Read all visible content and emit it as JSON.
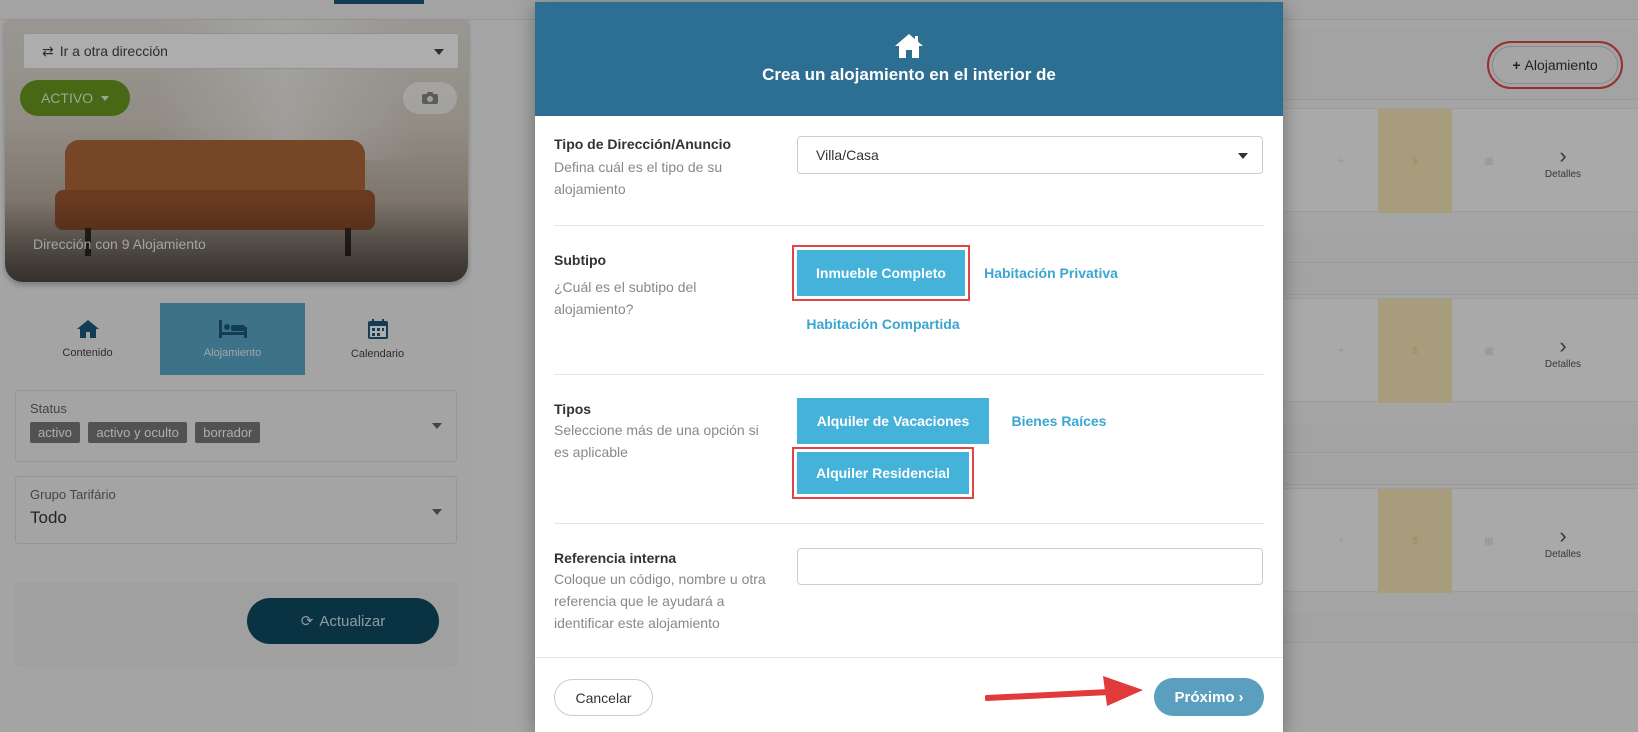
{
  "background": {
    "goto_select": {
      "label": "Ir a otra dirección"
    },
    "status_badge": "ACTIVO",
    "hero_caption": "Dirección con 9 Alojamiento",
    "nav_tabs": [
      {
        "label": "Contenido",
        "icon": "home-icon"
      },
      {
        "label": "Alojamiento",
        "icon": "bed-icon",
        "active": true
      },
      {
        "label": "Calendario",
        "icon": "calendar-icon"
      }
    ],
    "status_filter": {
      "label": "Status",
      "chips": [
        "activo",
        "activo y oculto",
        "borrador"
      ]
    },
    "tariff_filter": {
      "label": "Grupo Tarifário",
      "value": "Todo"
    },
    "update_button": "Actualizar",
    "add_lodging_button": "Alojamiento",
    "row_details_label": "Detalles"
  },
  "modal": {
    "title": "Crea un alojamiento en el interior de",
    "address_type": {
      "label": "Tipo de Dirección/Anuncio",
      "description": "Defina cuál es el tipo de su alojamiento",
      "selected": "Villa/Casa"
    },
    "subtype": {
      "label": "Subtipo",
      "description": "¿Cuál es el subtipo del alojamiento?",
      "options": [
        "Inmueble Completo",
        "Habitación Privativa",
        "Habitación Compartida"
      ]
    },
    "types": {
      "label": "Tipos",
      "description": "Seleccione más de una opción si es aplicable",
      "options": [
        "Alquiler de Vacaciones",
        "Bienes Raíces",
        "Alquiler Residencial"
      ]
    },
    "internal_ref": {
      "label": "Referencia interna",
      "description": "Coloque un código, nombre u otra referencia que le ayudará a identificar este alojamiento",
      "value": "",
      "placeholder": ""
    },
    "cancel_label": "Cancelar",
    "next_label": "Próximo"
  },
  "colors": {
    "header": "#2d6f92",
    "selected_option": "#45b2da",
    "link_option": "#3aa6d1",
    "next_button": "#5b9fbe",
    "highlight": "#e04444",
    "active_badge": "#6a9a1f"
  }
}
